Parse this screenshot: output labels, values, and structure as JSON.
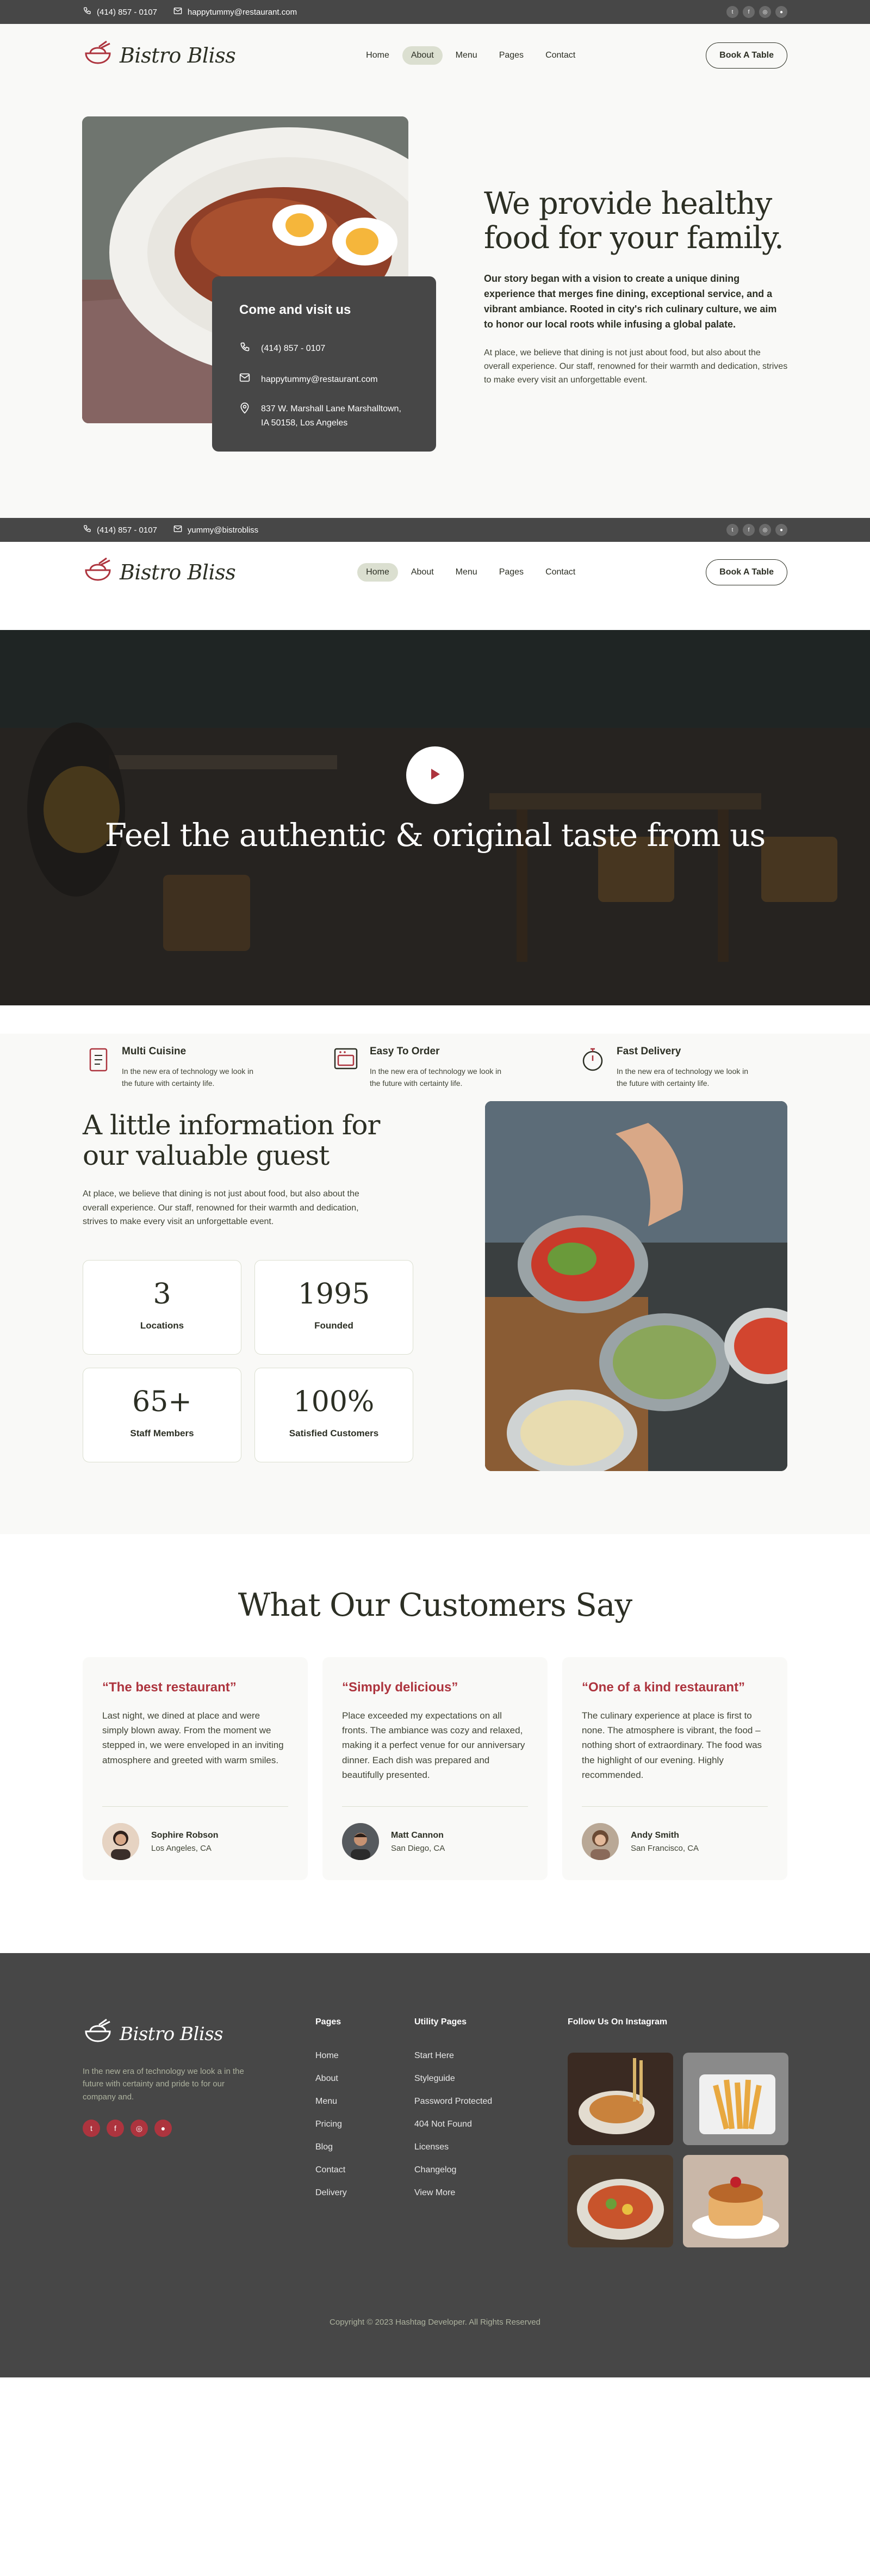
{
  "topbar": {
    "phone": "(414) 857 - 0107",
    "email": "happytummy@restaurant.com"
  },
  "topbar2": {
    "phone": "(414) 857 - 0107",
    "email": "yummy@bistrobliss"
  },
  "brand": {
    "name": "Bistro Bliss"
  },
  "nav": {
    "items": [
      "Home",
      "About",
      "Menu",
      "Pages",
      "Contact"
    ],
    "active_first": "About",
    "active_second": "Home",
    "book_label": "Book A Table"
  },
  "about": {
    "title": "We provide healthy food for your family.",
    "lead": "Our story began with a vision to create a unique dining experience that merges fine dining, exceptional service, and a vibrant ambiance. Rooted in city's rich culinary culture, we aim to honor our local roots while infusing a global palate.",
    "sub": "At place, we believe that dining is not just about food, but also about the overall experience. Our staff, renowned for their warmth and dedication, strives to make every visit an unforgettable event.",
    "card": {
      "title": "Come and visit us",
      "phone": "(414) 857 - 0107",
      "email": "happytummy@restaurant.com",
      "address": "837 W. Marshall Lane Marshalltown, IA 50158, Los Angeles"
    }
  },
  "hero": {
    "title": "Feel the authentic & original taste from us"
  },
  "features": [
    {
      "title": "Multi Cuisine",
      "text": "In the new era of technology we look in the future with certainty life.",
      "icon": "menu-book-icon"
    },
    {
      "title": "Easy To Order",
      "text": "In the new era of technology we look in the future with certainty life.",
      "icon": "oven-icon"
    },
    {
      "title": "Fast Delivery",
      "text": "In the new era of technology we look in the future with certainty life.",
      "icon": "stopwatch-icon"
    }
  ],
  "info": {
    "title": "A little information for our valuable guest",
    "text": "At place, we believe that dining is not just about food, but also about the overall experience. Our staff, renowned for their warmth and dedication, strives to make every visit an unforgettable event.",
    "stats": [
      {
        "n": "3",
        "l": "Locations"
      },
      {
        "n": "1995",
        "l": "Founded"
      },
      {
        "n": "65+",
        "l": "Staff Members"
      },
      {
        "n": "100%",
        "l": "Satisfied Customers"
      }
    ]
  },
  "testimonials": {
    "title": "What Our Customers Say",
    "items": [
      {
        "quote": "“The best restaurant”",
        "text": "Last night, we dined at place and were simply blown away. From the moment we stepped in, we were enveloped in an inviting atmosphere and greeted with warm smiles.",
        "name": "Sophire Robson",
        "loc": "Los Angeles, CA"
      },
      {
        "quote": "“Simply delicious”",
        "text": "Place exceeded my expectations on all fronts. The ambiance was cozy and relaxed, making it a perfect venue for our anniversary dinner. Each dish was prepared and beautifully presented.",
        "name": "Matt Cannon",
        "loc": "San Diego, CA"
      },
      {
        "quote": "“One of a kind restaurant”",
        "text": "The culinary experience at place is first to none. The atmosphere is vibrant, the food – nothing short of extraordinary. The food was the highlight of our evening. Highly recommended.",
        "name": "Andy Smith",
        "loc": "San Francisco, CA"
      }
    ]
  },
  "footer": {
    "brand": "Bistro Bliss",
    "desc": "In the new era of technology we look a in the future with certainty and pride to for our company and.",
    "pages_title": "Pages",
    "pages": [
      "Home",
      "About",
      "Menu",
      "Pricing",
      "Blog",
      "Contact",
      "Delivery"
    ],
    "utility_title": "Utility Pages",
    "utility": [
      "Start Here",
      "Styleguide",
      "Password Protected",
      "404 Not Found",
      "Licenses",
      "Changelog",
      "View More"
    ],
    "insta_title": "Follow Us On Instagram",
    "copyright": "Copyright © 2023 Hashtag Developer. All Rights Reserved"
  },
  "colors": {
    "accent": "#ad343e",
    "dark": "#474747",
    "bg": "#f9f9f7",
    "pill": "#dbdfd0"
  }
}
